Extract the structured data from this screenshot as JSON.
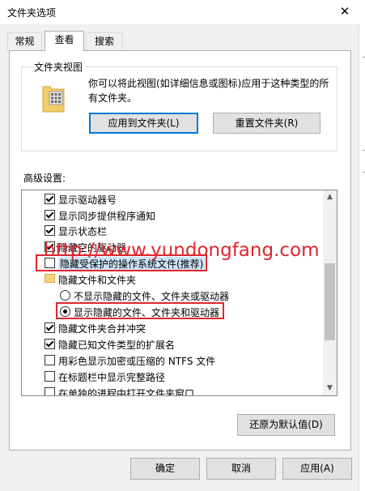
{
  "window": {
    "title": "文件夹选项",
    "close_glyph": "✕"
  },
  "tabs": [
    {
      "label": "常规"
    },
    {
      "label": "查看"
    },
    {
      "label": "搜索"
    }
  ],
  "folder_views": {
    "group_title": "文件夹视图",
    "description": "你可以将此视图(如详细信息或图标)应用于这种类型的所有文件夹。",
    "apply_button": "应用到文件夹(L)",
    "reset_button": "重置文件夹(R)"
  },
  "advanced": {
    "label": "高级设置:",
    "items": [
      {
        "type": "checkbox",
        "checked": true,
        "label": "显示驱动器号"
      },
      {
        "type": "checkbox",
        "checked": true,
        "label": "显示同步提供程序通知"
      },
      {
        "type": "checkbox",
        "checked": true,
        "label": "显示状态栏"
      },
      {
        "type": "checkbox",
        "checked": true,
        "label": "隐藏空的驱动器"
      },
      {
        "type": "checkbox",
        "checked": false,
        "label": "隐藏受保护的操作系统文件(推荐)"
      },
      {
        "type": "folder",
        "label": "隐藏文件和文件夹"
      },
      {
        "type": "radio",
        "checked": false,
        "label": "不显示隐藏的文件、文件夹或驱动器"
      },
      {
        "type": "radio",
        "checked": true,
        "label": "显示隐藏的文件、文件夹和驱动器"
      },
      {
        "type": "checkbox",
        "checked": true,
        "label": "隐藏文件夹合并冲突"
      },
      {
        "type": "checkbox",
        "checked": true,
        "label": "隐藏已知文件类型的扩展名"
      },
      {
        "type": "checkbox",
        "checked": false,
        "label": "用彩色显示加密或压缩的 NTFS 文件"
      },
      {
        "type": "checkbox",
        "checked": false,
        "label": "在标题栏中显示完整路径"
      },
      {
        "type": "checkbox",
        "checked": false,
        "label": "在单独的进程中打开文件夹窗口"
      }
    ]
  },
  "watermark": "http://www.yundongfang.com",
  "restore_defaults_button": "还原为默认值(D)",
  "footer": {
    "ok": "确定",
    "cancel": "取消",
    "apply": "应用(A)"
  }
}
